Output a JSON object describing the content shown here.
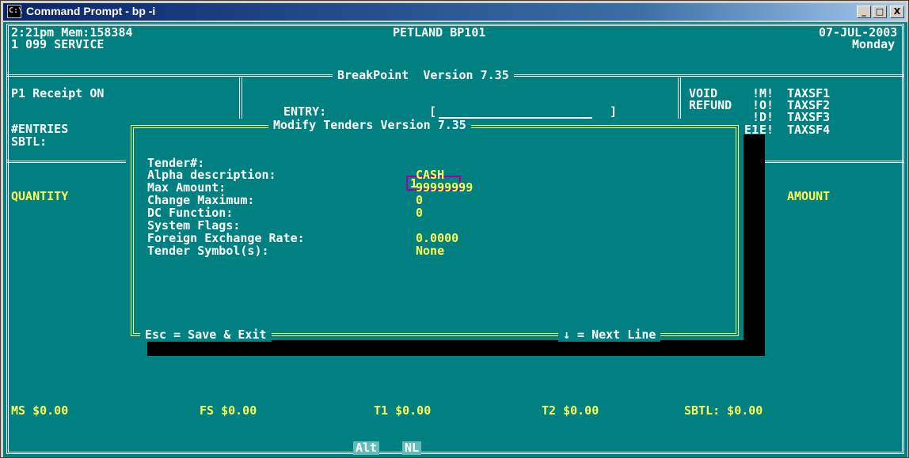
{
  "window": {
    "title": "Command Prompt - bp -i",
    "icon": "console-icon",
    "buttons": {
      "minimize": "_",
      "maximize": "□",
      "close": "X"
    }
  },
  "header": {
    "time_mem": "2:21pm Mem:158384",
    "user": "1 099 SERVICE",
    "store": "PETLAND BP101",
    "date": "07-JUL-2003",
    "day": "Monday",
    "app_version": "BreakPoint  Version 7.35"
  },
  "left_panel": {
    "receipt": "P1 Receipt ON",
    "entries": "#ENTRIES",
    "sbtl": "SBTL:"
  },
  "center_panel": {
    "entry_label": "ENTRY:",
    "entry_open": "[",
    "entry_close": "]"
  },
  "right_panel": {
    "rows": [
      {
        "label": "VOID",
        "key": "!M!",
        "tax": "TAXSF1"
      },
      {
        "label": "REFUND",
        "key": "!O!",
        "tax": "TAXSF2"
      },
      {
        "label": "",
        "key": "!D!",
        "tax": "TAXSF3"
      },
      {
        "label": "E1",
        "key": "!E!",
        "tax": "TAXSF4"
      }
    ]
  },
  "columns": {
    "quantity": "QUANTITY",
    "amount": "AMOUNT"
  },
  "dialog": {
    "title": "Modify Tenders Version 7.35",
    "fields": [
      {
        "label": "Tender#:",
        "value": "1"
      },
      {
        "label": "Alpha description:",
        "value": "CASH"
      },
      {
        "label": "Max Amount:",
        "value": "99999999"
      },
      {
        "label": "Change Maximum:",
        "value": "0"
      },
      {
        "label": "DC Function:",
        "value": "0"
      },
      {
        "label": "System Flags:",
        "value": ""
      },
      {
        "label": "Foreign Exchange Rate:",
        "value": "0.0000"
      },
      {
        "label": "Tender Symbol(s):",
        "value": "None"
      }
    ],
    "footer_left": "Esc = Save & Exit",
    "footer_right": "↓ = Next Line"
  },
  "totals": {
    "ms": "MS $0.00",
    "fs": "FS $0.00",
    "t1": "T1 $0.00",
    "t2": "T2 $0.00",
    "sbtl": "SBTL: $0.00"
  },
  "status_bar": {
    "alt": "Alt",
    "nl": "NL"
  },
  "colors": {
    "console_bg": "#008080",
    "text": "#ffffff",
    "value": "#ffff55",
    "title_bar": "#0a246a"
  }
}
